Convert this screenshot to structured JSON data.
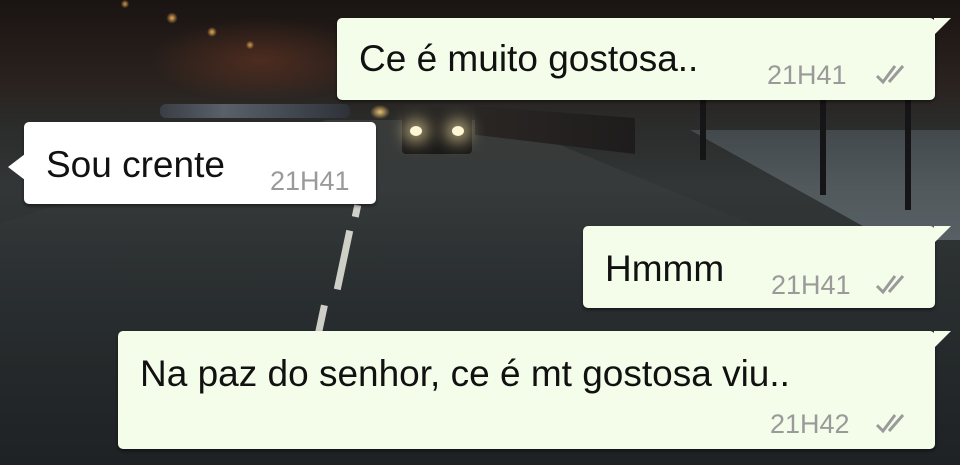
{
  "messages": [
    {
      "direction": "sent",
      "text": "Ce é muito gostosa..",
      "time": "21H41",
      "status_icon": "double-check-icon"
    },
    {
      "direction": "received",
      "text": "Sou crente",
      "time": "21H41"
    },
    {
      "direction": "sent",
      "text": "Hmmm",
      "time": "21H41",
      "status_icon": "double-check-icon"
    },
    {
      "direction": "sent",
      "text": "Na paz do senhor, ce é mt gostosa viu..",
      "time": "21H42",
      "status_icon": "double-check-icon"
    }
  ],
  "colors": {
    "sent_bubble": "#f3fde9",
    "received_bubble": "#ffffff",
    "message_text": "#111111",
    "timestamp": "#9a9a9a",
    "tick": "#9a9a9a"
  },
  "wallpaper": "night-city-street-photo"
}
